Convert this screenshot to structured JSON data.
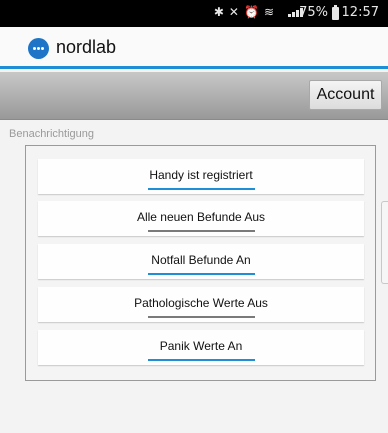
{
  "status_bar": {
    "battery": "75%",
    "time": "12:57",
    "icons": [
      "bluetooth-icon",
      "mute-icon",
      "alarm-icon",
      "wifi-icon",
      "signal-icon",
      "battery-icon"
    ]
  },
  "app": {
    "name": "nordlab",
    "accent": "#1e8fd6",
    "logo_color": "#1e74c6"
  },
  "toolbar": {
    "account_label": "Account"
  },
  "notifications": {
    "section_label": "Benachrichtigung",
    "buttons": [
      {
        "label": "Handy ist registriert",
        "state": "on"
      },
      {
        "label": "Alle neuen Befunde Aus",
        "state": "off"
      },
      {
        "label": "Notfall Befunde An",
        "state": "on"
      },
      {
        "label": "Pathologische Werte Aus",
        "state": "off"
      },
      {
        "label": "Panik Werte An",
        "state": "on"
      }
    ]
  }
}
